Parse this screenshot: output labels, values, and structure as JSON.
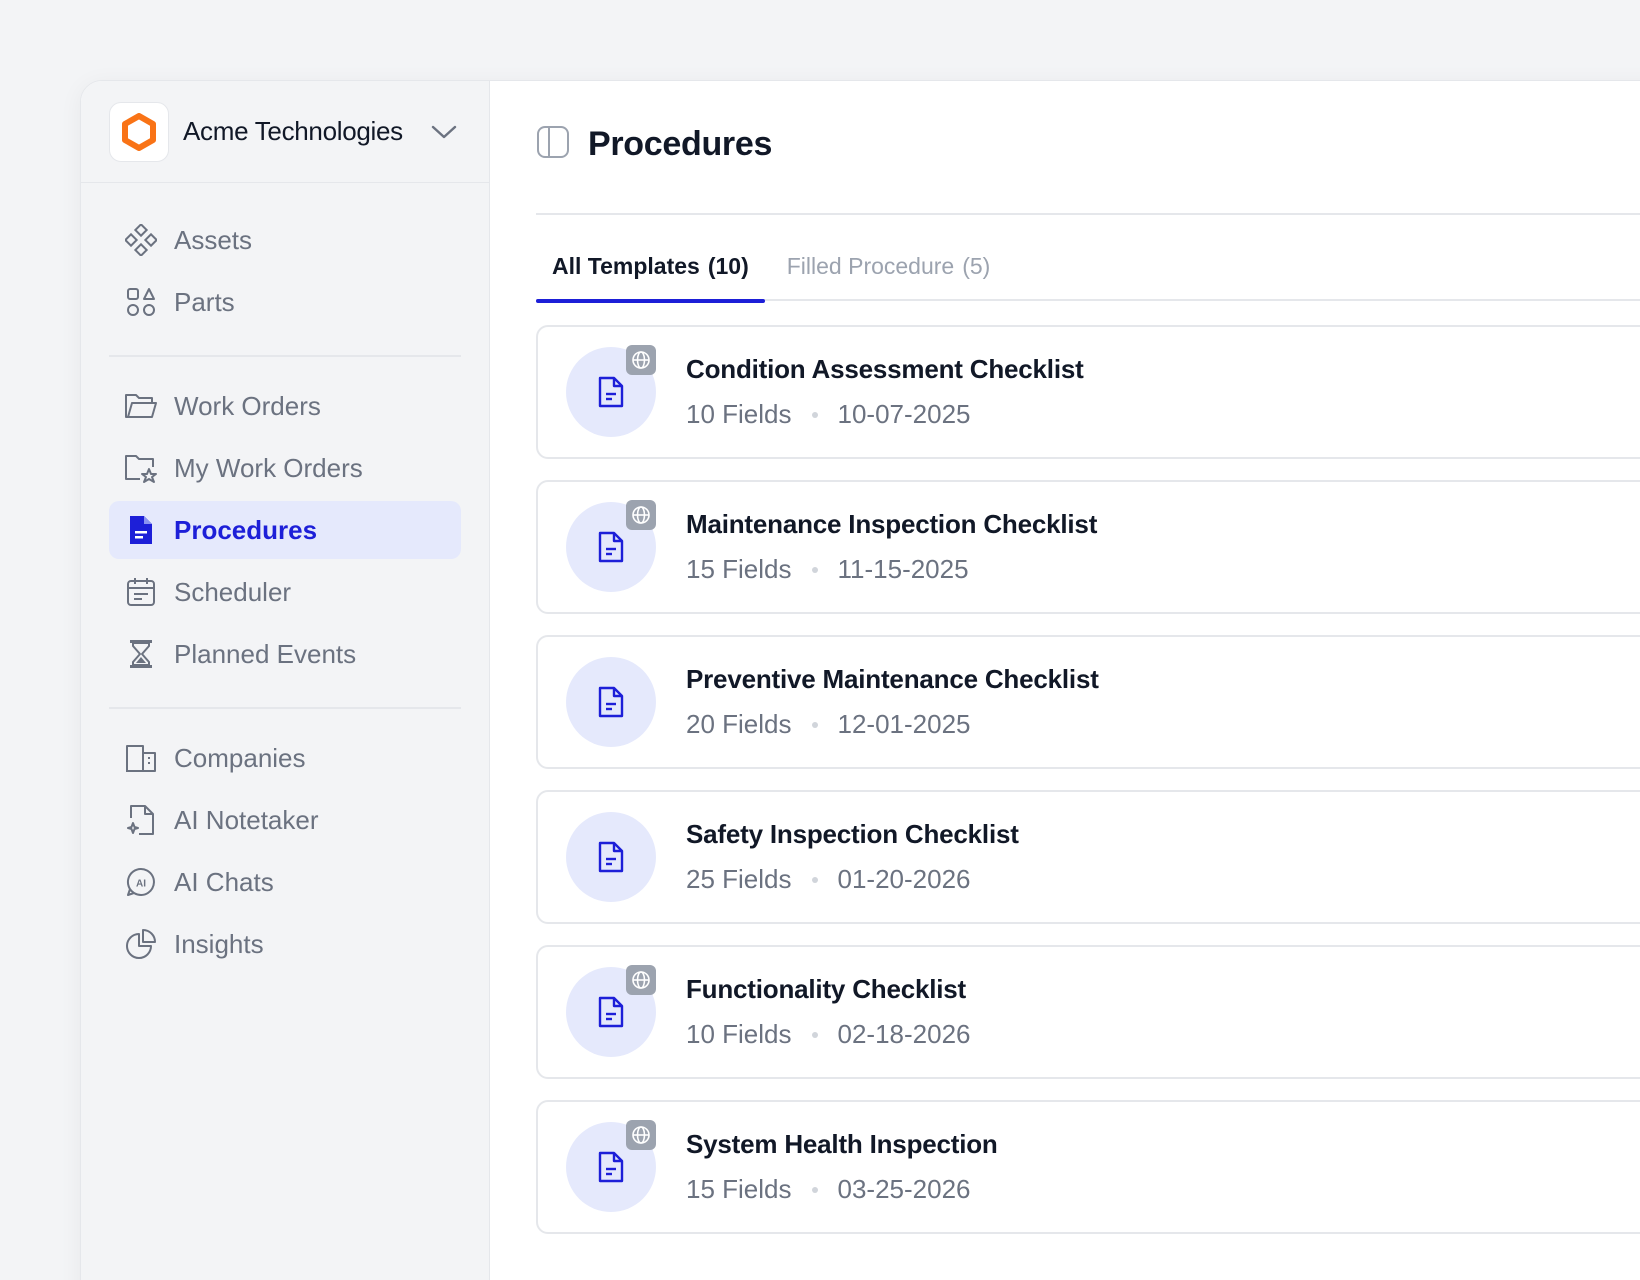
{
  "org": {
    "name": "Acme Technologies"
  },
  "sidebar": {
    "items": [
      {
        "label": "Assets",
        "icon": "assets-icon"
      },
      {
        "label": "Parts",
        "icon": "parts-icon"
      },
      {
        "label": "Work Orders",
        "icon": "folder-icon"
      },
      {
        "label": "My Work Orders",
        "icon": "folder-star-icon"
      },
      {
        "label": "Procedures",
        "icon": "document-icon",
        "active": true
      },
      {
        "label": "Scheduler",
        "icon": "calendar-icon"
      },
      {
        "label": "Planned Events",
        "icon": "hourglass-icon"
      },
      {
        "label": "Companies",
        "icon": "building-icon"
      },
      {
        "label": "AI Notetaker",
        "icon": "ai-note-icon"
      },
      {
        "label": "AI Chats",
        "icon": "ai-chat-icon"
      },
      {
        "label": "Insights",
        "icon": "pie-chart-icon"
      }
    ]
  },
  "page": {
    "title": "Procedures"
  },
  "tabs": [
    {
      "label": "All Templates",
      "count": "(10)",
      "active": true
    },
    {
      "label": "Filled Procedure",
      "count": "(5)",
      "active": false
    }
  ],
  "procedures": [
    {
      "title": "Condition Assessment Checklist",
      "fields": "10 Fields",
      "date": "10-07-2025",
      "public": true
    },
    {
      "title": "Maintenance Inspection Checklist",
      "fields": "15 Fields",
      "date": "11-15-2025",
      "public": true
    },
    {
      "title": "Preventive Maintenance Checklist",
      "fields": "20 Fields",
      "date": "12-01-2025",
      "public": false
    },
    {
      "title": "Safety Inspection Checklist",
      "fields": "25 Fields",
      "date": "01-20-2026",
      "public": false
    },
    {
      "title": "Functionality Checklist",
      "fields": "10 Fields",
      "date": "02-18-2026",
      "public": true
    },
    {
      "title": "System Health Inspection",
      "fields": "15 Fields",
      "date": "03-25-2026",
      "public": true
    }
  ],
  "colors": {
    "accent": "#1d1fd8",
    "brand_orange": "#f97316",
    "active_bg": "#e5e9fc",
    "text_primary": "#111827",
    "text_secondary": "#6b7280"
  }
}
